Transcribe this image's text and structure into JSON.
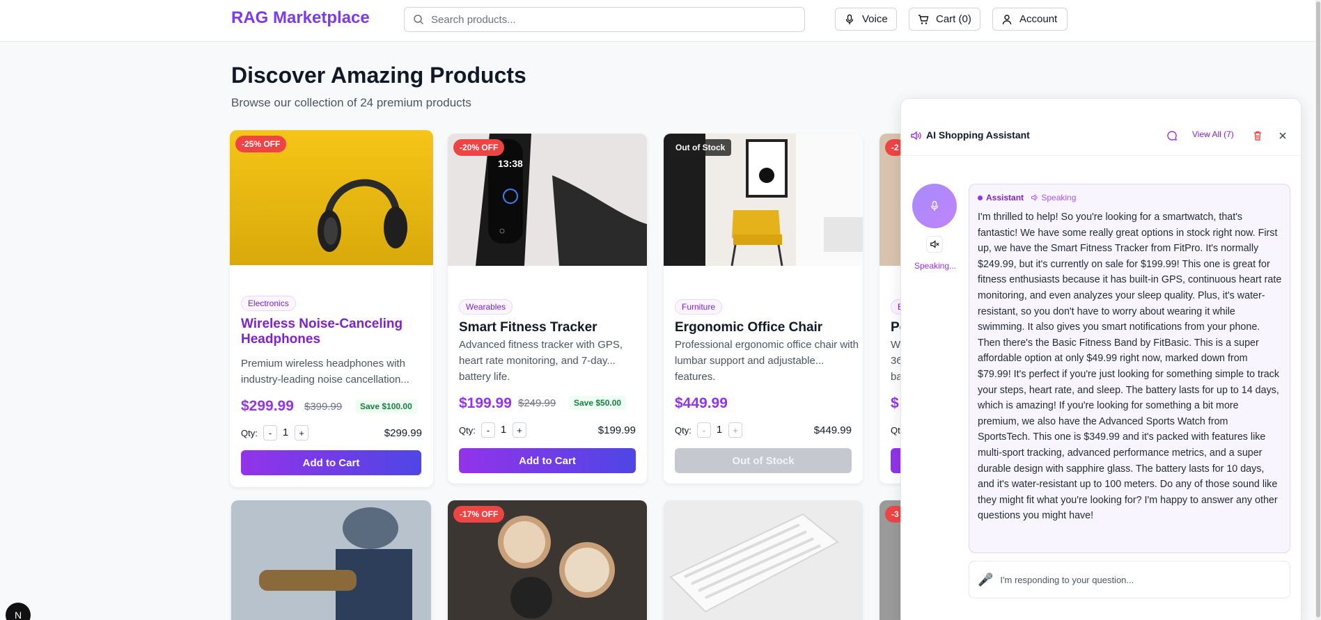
{
  "header": {
    "brand": "RAG Marketplace",
    "search_placeholder": "Search products...",
    "voice_label": "Voice",
    "cart_label": "Cart (0)",
    "account_label": "Account"
  },
  "main": {
    "title": "Discover Amazing Products",
    "subtitle": "Browse our collection of 24 premium products"
  },
  "products": [
    {
      "badge": "-25% OFF",
      "category": "Electronics",
      "name": "Wireless Noise-Canceling Headphones",
      "description": "Premium wireless headphones with industry-leading noise cancellation...",
      "price": "$299.99",
      "old_price": "$399.99",
      "save": "Save $100.00",
      "qty_label": "Qty:",
      "qty": "1",
      "total": "$299.99",
      "button": "Add to Cart"
    },
    {
      "badge": "-20% OFF",
      "category": "Wearables",
      "name": "Smart Fitness Tracker",
      "description": "Advanced fitness tracker with GPS, heart rate monitoring, and 7-day... battery life.",
      "price": "$199.99",
      "old_price": "$249.99",
      "save": "Save $50.00",
      "qty_label": "Qty:",
      "qty": "1",
      "total": "$199.99",
      "button": "Add to Cart"
    },
    {
      "badge": "Out of Stock",
      "category": "Furniture",
      "name": "Ergonomic Office Chair",
      "description": "Professional ergonomic office chair with lumbar support and adjustable... features.",
      "price": "$449.99",
      "qty_label": "Qty:",
      "qty": "1",
      "total": "$449.99",
      "button": "Out of Stock"
    },
    {
      "badge": "-2",
      "category": "E",
      "name": "Po",
      "description": "Wa 36 ba",
      "price": "$",
      "qty_label": "Qt"
    }
  ],
  "row2_badges": [
    "-17% OFF",
    "-3"
  ],
  "assistant": {
    "title": "AI Shopping Assistant",
    "view_all": "View All (7)",
    "status": "Speaking...",
    "role": "Assistant",
    "speaking_tag": "Speaking",
    "message": "I'm thrilled to help! So you're looking for a smartwatch, that's fantastic! We have some really great options in stock right now. First up, we have the Smart Fitness Tracker from FitPro. It's normally $249.99, but it's currently on sale for $199.99! This one is great for fitness enthusiasts because it has built-in GPS, continuous heart rate monitoring, and even analyzes your sleep quality. Plus, it's water-resistant, so you don't have to worry about wearing it while swimming. It also gives you smart notifications from your phone. Then there's the Basic Fitness Band by FitBasic. This is a super affordable option at only $49.99 right now, marked down from $79.99! It's perfect if you're just looking for something simple to track your steps, heart rate, and sleep. The battery lasts for up to 14 days, which is amazing! If you're looking for something a bit more premium, we also have the Advanced Sports Watch from SportsTech. This one is $349.99 and it's packed with features like multi-sport tracking, advanced performance metrics, and a super durable design with sapphire glass. The battery lasts for 10 days, and it's water-resistant up to 100 meters. Do any of those sound like they might fit what you're looking for? I'm happy to answer any other questions you might have!",
    "reply_placeholder": "I'm responding to your question..."
  },
  "dev_badge": "N",
  "colors": {
    "accent": "#9333ea",
    "brand": "#7c3aed",
    "sale": "#ef4444",
    "save_text": "#15803d"
  }
}
